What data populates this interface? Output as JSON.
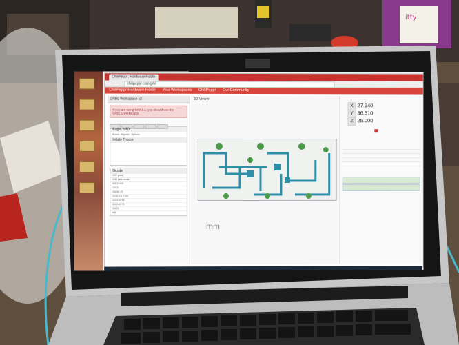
{
  "browser": {
    "tab_title": "ChiliPeppr: Hardware Fiddle",
    "url": "chilipeppr.com/grbl",
    "menu": [
      "ChiliPeppr Hardware Fiddle",
      "Your Workspaces",
      "ChiliPeppr",
      "Our Community"
    ]
  },
  "left_panel": {
    "title": "GRBL Workspace v2",
    "alert": "If you are using Grbl 1.1, you should use the Grbl1.1 workspace.",
    "eagle_title": "Eagle BRD",
    "eagle_tabs": [
      "Board",
      "Signals",
      "Options"
    ],
    "inflate_title": "Inflate Traces",
    "gcode_title": "Gcode",
    "gcode_lines": [
      "G21 (mm)",
      "G90 (abs mode)",
      "M3 S1000",
      "G0 Z1",
      "G0 X0 Y0",
      "G1 Z-0.1 F100",
      "G1 X10 Y5",
      "G1 X20 Y5",
      "G0 Z1",
      "M5"
    ]
  },
  "viewer": {
    "title": "3D Viewer",
    "unit_label": "mm"
  },
  "right_panel": {
    "axes": [
      {
        "letter": "X",
        "value": "27.940"
      },
      {
        "letter": "Y",
        "value": "36.510"
      },
      {
        "letter": "Z",
        "value": "25.000"
      }
    ]
  },
  "colors": {
    "chrome_red": "#c8332f",
    "trace_teal": "#2f8fa8",
    "pad_green": "#4a9a4a"
  }
}
